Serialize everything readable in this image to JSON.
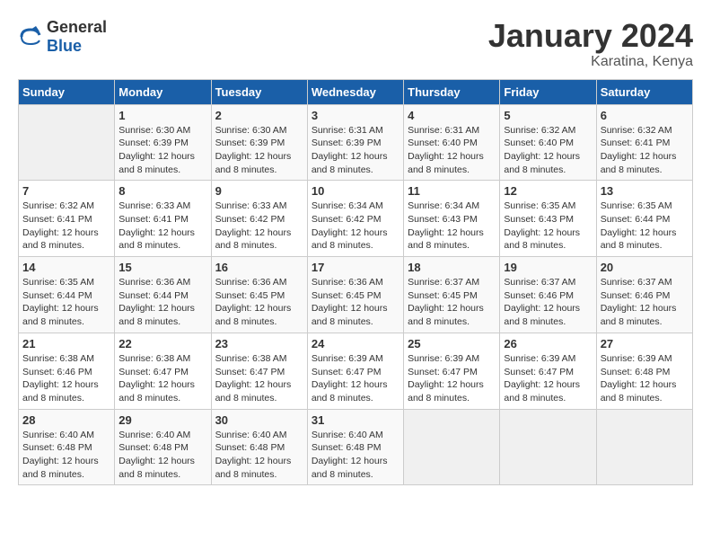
{
  "app": {
    "logo_general": "General",
    "logo_blue": "Blue"
  },
  "calendar": {
    "title": "January 2024",
    "location": "Karatina, Kenya",
    "days_of_week": [
      "Sunday",
      "Monday",
      "Tuesday",
      "Wednesday",
      "Thursday",
      "Friday",
      "Saturday"
    ],
    "weeks": [
      [
        {
          "day": "",
          "info": ""
        },
        {
          "day": "1",
          "info": "Sunrise: 6:30 AM\nSunset: 6:39 PM\nDaylight: 12 hours\nand 8 minutes."
        },
        {
          "day": "2",
          "info": "Sunrise: 6:30 AM\nSunset: 6:39 PM\nDaylight: 12 hours\nand 8 minutes."
        },
        {
          "day": "3",
          "info": "Sunrise: 6:31 AM\nSunset: 6:39 PM\nDaylight: 12 hours\nand 8 minutes."
        },
        {
          "day": "4",
          "info": "Sunrise: 6:31 AM\nSunset: 6:40 PM\nDaylight: 12 hours\nand 8 minutes."
        },
        {
          "day": "5",
          "info": "Sunrise: 6:32 AM\nSunset: 6:40 PM\nDaylight: 12 hours\nand 8 minutes."
        },
        {
          "day": "6",
          "info": "Sunrise: 6:32 AM\nSunset: 6:41 PM\nDaylight: 12 hours\nand 8 minutes."
        }
      ],
      [
        {
          "day": "7",
          "info": "Sunrise: 6:32 AM\nSunset: 6:41 PM\nDaylight: 12 hours\nand 8 minutes."
        },
        {
          "day": "8",
          "info": "Sunrise: 6:33 AM\nSunset: 6:41 PM\nDaylight: 12 hours\nand 8 minutes."
        },
        {
          "day": "9",
          "info": "Sunrise: 6:33 AM\nSunset: 6:42 PM\nDaylight: 12 hours\nand 8 minutes."
        },
        {
          "day": "10",
          "info": "Sunrise: 6:34 AM\nSunset: 6:42 PM\nDaylight: 12 hours\nand 8 minutes."
        },
        {
          "day": "11",
          "info": "Sunrise: 6:34 AM\nSunset: 6:43 PM\nDaylight: 12 hours\nand 8 minutes."
        },
        {
          "day": "12",
          "info": "Sunrise: 6:35 AM\nSunset: 6:43 PM\nDaylight: 12 hours\nand 8 minutes."
        },
        {
          "day": "13",
          "info": "Sunrise: 6:35 AM\nSunset: 6:44 PM\nDaylight: 12 hours\nand 8 minutes."
        }
      ],
      [
        {
          "day": "14",
          "info": "Sunrise: 6:35 AM\nSunset: 6:44 PM\nDaylight: 12 hours\nand 8 minutes."
        },
        {
          "day": "15",
          "info": "Sunrise: 6:36 AM\nSunset: 6:44 PM\nDaylight: 12 hours\nand 8 minutes."
        },
        {
          "day": "16",
          "info": "Sunrise: 6:36 AM\nSunset: 6:45 PM\nDaylight: 12 hours\nand 8 minutes."
        },
        {
          "day": "17",
          "info": "Sunrise: 6:36 AM\nSunset: 6:45 PM\nDaylight: 12 hours\nand 8 minutes."
        },
        {
          "day": "18",
          "info": "Sunrise: 6:37 AM\nSunset: 6:45 PM\nDaylight: 12 hours\nand 8 minutes."
        },
        {
          "day": "19",
          "info": "Sunrise: 6:37 AM\nSunset: 6:46 PM\nDaylight: 12 hours\nand 8 minutes."
        },
        {
          "day": "20",
          "info": "Sunrise: 6:37 AM\nSunset: 6:46 PM\nDaylight: 12 hours\nand 8 minutes."
        }
      ],
      [
        {
          "day": "21",
          "info": "Sunrise: 6:38 AM\nSunset: 6:46 PM\nDaylight: 12 hours\nand 8 minutes."
        },
        {
          "day": "22",
          "info": "Sunrise: 6:38 AM\nSunset: 6:47 PM\nDaylight: 12 hours\nand 8 minutes."
        },
        {
          "day": "23",
          "info": "Sunrise: 6:38 AM\nSunset: 6:47 PM\nDaylight: 12 hours\nand 8 minutes."
        },
        {
          "day": "24",
          "info": "Sunrise: 6:39 AM\nSunset: 6:47 PM\nDaylight: 12 hours\nand 8 minutes."
        },
        {
          "day": "25",
          "info": "Sunrise: 6:39 AM\nSunset: 6:47 PM\nDaylight: 12 hours\nand 8 minutes."
        },
        {
          "day": "26",
          "info": "Sunrise: 6:39 AM\nSunset: 6:47 PM\nDaylight: 12 hours\nand 8 minutes."
        },
        {
          "day": "27",
          "info": "Sunrise: 6:39 AM\nSunset: 6:48 PM\nDaylight: 12 hours\nand 8 minutes."
        }
      ],
      [
        {
          "day": "28",
          "info": "Sunrise: 6:40 AM\nSunset: 6:48 PM\nDaylight: 12 hours\nand 8 minutes."
        },
        {
          "day": "29",
          "info": "Sunrise: 6:40 AM\nSunset: 6:48 PM\nDaylight: 12 hours\nand 8 minutes."
        },
        {
          "day": "30",
          "info": "Sunrise: 6:40 AM\nSunset: 6:48 PM\nDaylight: 12 hours\nand 8 minutes."
        },
        {
          "day": "31",
          "info": "Sunrise: 6:40 AM\nSunset: 6:48 PM\nDaylight: 12 hours\nand 8 minutes."
        },
        {
          "day": "",
          "info": ""
        },
        {
          "day": "",
          "info": ""
        },
        {
          "day": "",
          "info": ""
        }
      ]
    ]
  }
}
